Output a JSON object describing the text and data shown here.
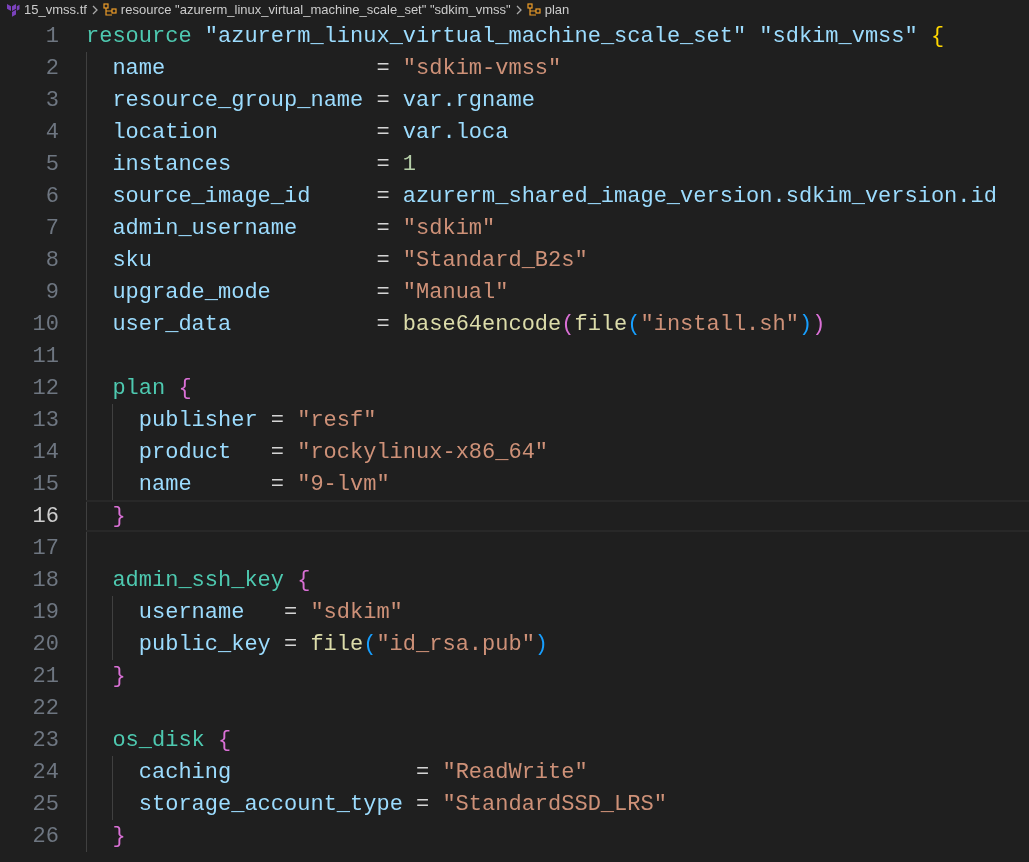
{
  "breadcrumb": [
    {
      "kind": "file",
      "label": "15_vmss.tf"
    },
    {
      "kind": "symbol",
      "label": "resource \"azurerm_linux_virtual_machine_scale_set\" \"sdkim_vmss\""
    },
    {
      "kind": "symbol",
      "label": "plan"
    }
  ],
  "lines": [
    {
      "number": "1",
      "kind": "block",
      "current": false,
      "head": [
        {
          "kind": "keyword",
          "text": "resource"
        },
        {
          "kind": "label",
          "text": "\"azurerm_linux_virtual_machine_scale_set\""
        },
        {
          "kind": "label",
          "text": "\"sdkim_vmss\""
        },
        {
          "kind": "bracket",
          "text": "{",
          "color": "#ffd700"
        }
      ],
      "children": [
        {
          "number": "2",
          "kind": "attribute",
          "current": false,
          "key": "name",
          "operator": "=",
          "value": [
            {
              "kind": "string",
              "text": "\"sdkim-vmss\""
            }
          ]
        },
        {
          "number": "3",
          "kind": "attribute",
          "current": false,
          "key": "resource_group_name",
          "operator": "=",
          "value": [
            {
              "kind": "ident",
              "text": "var.rgname"
            }
          ]
        },
        {
          "number": "4",
          "kind": "attribute",
          "current": false,
          "key": "location",
          "operator": "=",
          "value": [
            {
              "kind": "ident",
              "text": "var.loca"
            }
          ]
        },
        {
          "number": "5",
          "kind": "attribute",
          "current": false,
          "key": "instances",
          "operator": "=",
          "value": [
            {
              "kind": "number",
              "text": "1"
            }
          ]
        },
        {
          "number": "6",
          "kind": "attribute",
          "current": false,
          "key": "source_image_id",
          "operator": "=",
          "value": [
            {
              "kind": "ident",
              "text": "azurerm_shared_image_version.sdkim_version.id"
            }
          ]
        },
        {
          "number": "7",
          "kind": "attribute",
          "current": false,
          "key": "admin_username",
          "operator": "=",
          "value": [
            {
              "kind": "string",
              "text": "\"sdkim\""
            }
          ]
        },
        {
          "number": "8",
          "kind": "attribute",
          "current": false,
          "key": "sku",
          "operator": "=",
          "value": [
            {
              "kind": "string",
              "text": "\"Standard_B2s\""
            }
          ]
        },
        {
          "number": "9",
          "kind": "attribute",
          "current": false,
          "key": "upgrade_mode",
          "operator": "=",
          "value": [
            {
              "kind": "string",
              "text": "\"Manual\""
            }
          ]
        },
        {
          "number": "10",
          "kind": "attribute",
          "current": false,
          "key": "user_data",
          "operator": "=",
          "value": [
            {
              "kind": "func",
              "text": "base64encode"
            },
            {
              "kind": "bracket",
              "text": "(",
              "color": "#da70d6"
            },
            {
              "kind": "func",
              "text": "file"
            },
            {
              "kind": "bracket",
              "text": "(",
              "color": "#179fff"
            },
            {
              "kind": "string",
              "text": "\"install.sh\""
            },
            {
              "kind": "bracket",
              "text": ")",
              "color": "#179fff"
            },
            {
              "kind": "bracket",
              "text": ")",
              "color": "#da70d6"
            }
          ]
        },
        {
          "number": "11",
          "kind": "empty",
          "current": false
        },
        {
          "number": "12",
          "kind": "block",
          "current": false,
          "head": [
            {
              "kind": "keyword",
              "text": "plan"
            },
            {
              "kind": "bracket",
              "text": "{",
              "color": "#da70d6"
            }
          ],
          "children": [
            {
              "number": "13",
              "kind": "attribute",
              "current": false,
              "key": "publisher",
              "operator": "=",
              "value": [
                {
                  "kind": "string",
                  "text": "\"resf\""
                }
              ]
            },
            {
              "number": "14",
              "kind": "attribute",
              "current": false,
              "key": "product",
              "operator": "=",
              "value": [
                {
                  "kind": "string",
                  "text": "\"rockylinux-x86_64\""
                }
              ]
            },
            {
              "number": "15",
              "kind": "attribute",
              "current": false,
              "key": "name",
              "operator": "=",
              "value": [
                {
                  "kind": "string",
                  "text": "\"9-lvm\""
                }
              ]
            }
          ]
        },
        {
          "number": "16",
          "kind": "close",
          "current": true,
          "tokens": [
            {
              "kind": "bracket",
              "text": "}",
              "color": "#da70d6"
            }
          ]
        },
        {
          "number": "17",
          "kind": "empty",
          "current": false
        },
        {
          "number": "18",
          "kind": "block",
          "current": false,
          "head": [
            {
              "kind": "keyword",
              "text": "admin_ssh_key"
            },
            {
              "kind": "bracket",
              "text": "{",
              "color": "#da70d6"
            }
          ],
          "children": [
            {
              "number": "19",
              "kind": "attribute",
              "current": false,
              "key": "username",
              "operator": "=",
              "value": [
                {
                  "kind": "string",
                  "text": "\"sdkim\""
                }
              ]
            },
            {
              "number": "20",
              "kind": "attribute",
              "current": false,
              "key": "public_key",
              "operator": "=",
              "value": [
                {
                  "kind": "func",
                  "text": "file"
                },
                {
                  "kind": "bracket",
                  "text": "(",
                  "color": "#179fff"
                },
                {
                  "kind": "string",
                  "text": "\"id_rsa.pub\""
                },
                {
                  "kind": "bracket",
                  "text": ")",
                  "color": "#179fff"
                }
              ]
            }
          ]
        },
        {
          "number": "21",
          "kind": "close",
          "current": false,
          "tokens": [
            {
              "kind": "bracket",
              "text": "}",
              "color": "#da70d6"
            }
          ]
        },
        {
          "number": "22",
          "kind": "empty",
          "current": false
        },
        {
          "number": "23",
          "kind": "block",
          "current": false,
          "head": [
            {
              "kind": "keyword",
              "text": "os_disk"
            },
            {
              "kind": "bracket",
              "text": "{",
              "color": "#da70d6"
            }
          ],
          "children": [
            {
              "number": "24",
              "kind": "attribute",
              "current": false,
              "key": "caching",
              "operator": "=",
              "value": [
                {
                  "kind": "string",
                  "text": "\"ReadWrite\""
                }
              ]
            },
            {
              "number": "25",
              "kind": "attribute",
              "current": false,
              "key": "storage_account_type",
              "operator": "=",
              "value": [
                {
                  "kind": "string",
                  "text": "\"StandardSSD_LRS\""
                }
              ]
            }
          ]
        },
        {
          "number": "26",
          "kind": "close",
          "current": false,
          "tokens": [
            {
              "kind": "bracket",
              "text": "}",
              "color": "#da70d6"
            }
          ]
        }
      ]
    }
  ]
}
